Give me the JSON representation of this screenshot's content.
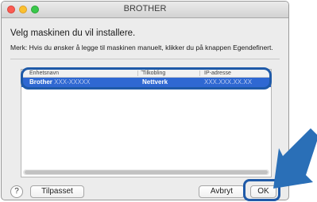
{
  "window": {
    "title": "BROTHER"
  },
  "content": {
    "heading": "Velg maskinen du vil installere.",
    "note": "Merk: Hvis du ønsker å legge til maskinen manuelt, klikker du på knappen Egendefinert."
  },
  "table": {
    "columns": [
      "Enhetsnavn",
      "Tilkobling",
      "IP-adresse"
    ],
    "selected_row": {
      "name_prefix": "Brother",
      "name_masked": "XXX-XXXXX",
      "connection": "Nettverk",
      "ip": "XXX.XXX.XX.XX"
    }
  },
  "buttons": {
    "help": "?",
    "tilpasset": "Tilpasset",
    "avbryt": "Avbryt",
    "ok": "OK"
  },
  "colors": {
    "selection": "#2f68d2",
    "annotation_blue": "#1f5aa8",
    "callout_arrow": "#2a6fb7"
  },
  "icons": [
    "close-traffic-light",
    "minimize-traffic-light",
    "zoom-traffic-light",
    "sort-arrow-icon",
    "help-icon",
    "callout-arrow-icon"
  ]
}
